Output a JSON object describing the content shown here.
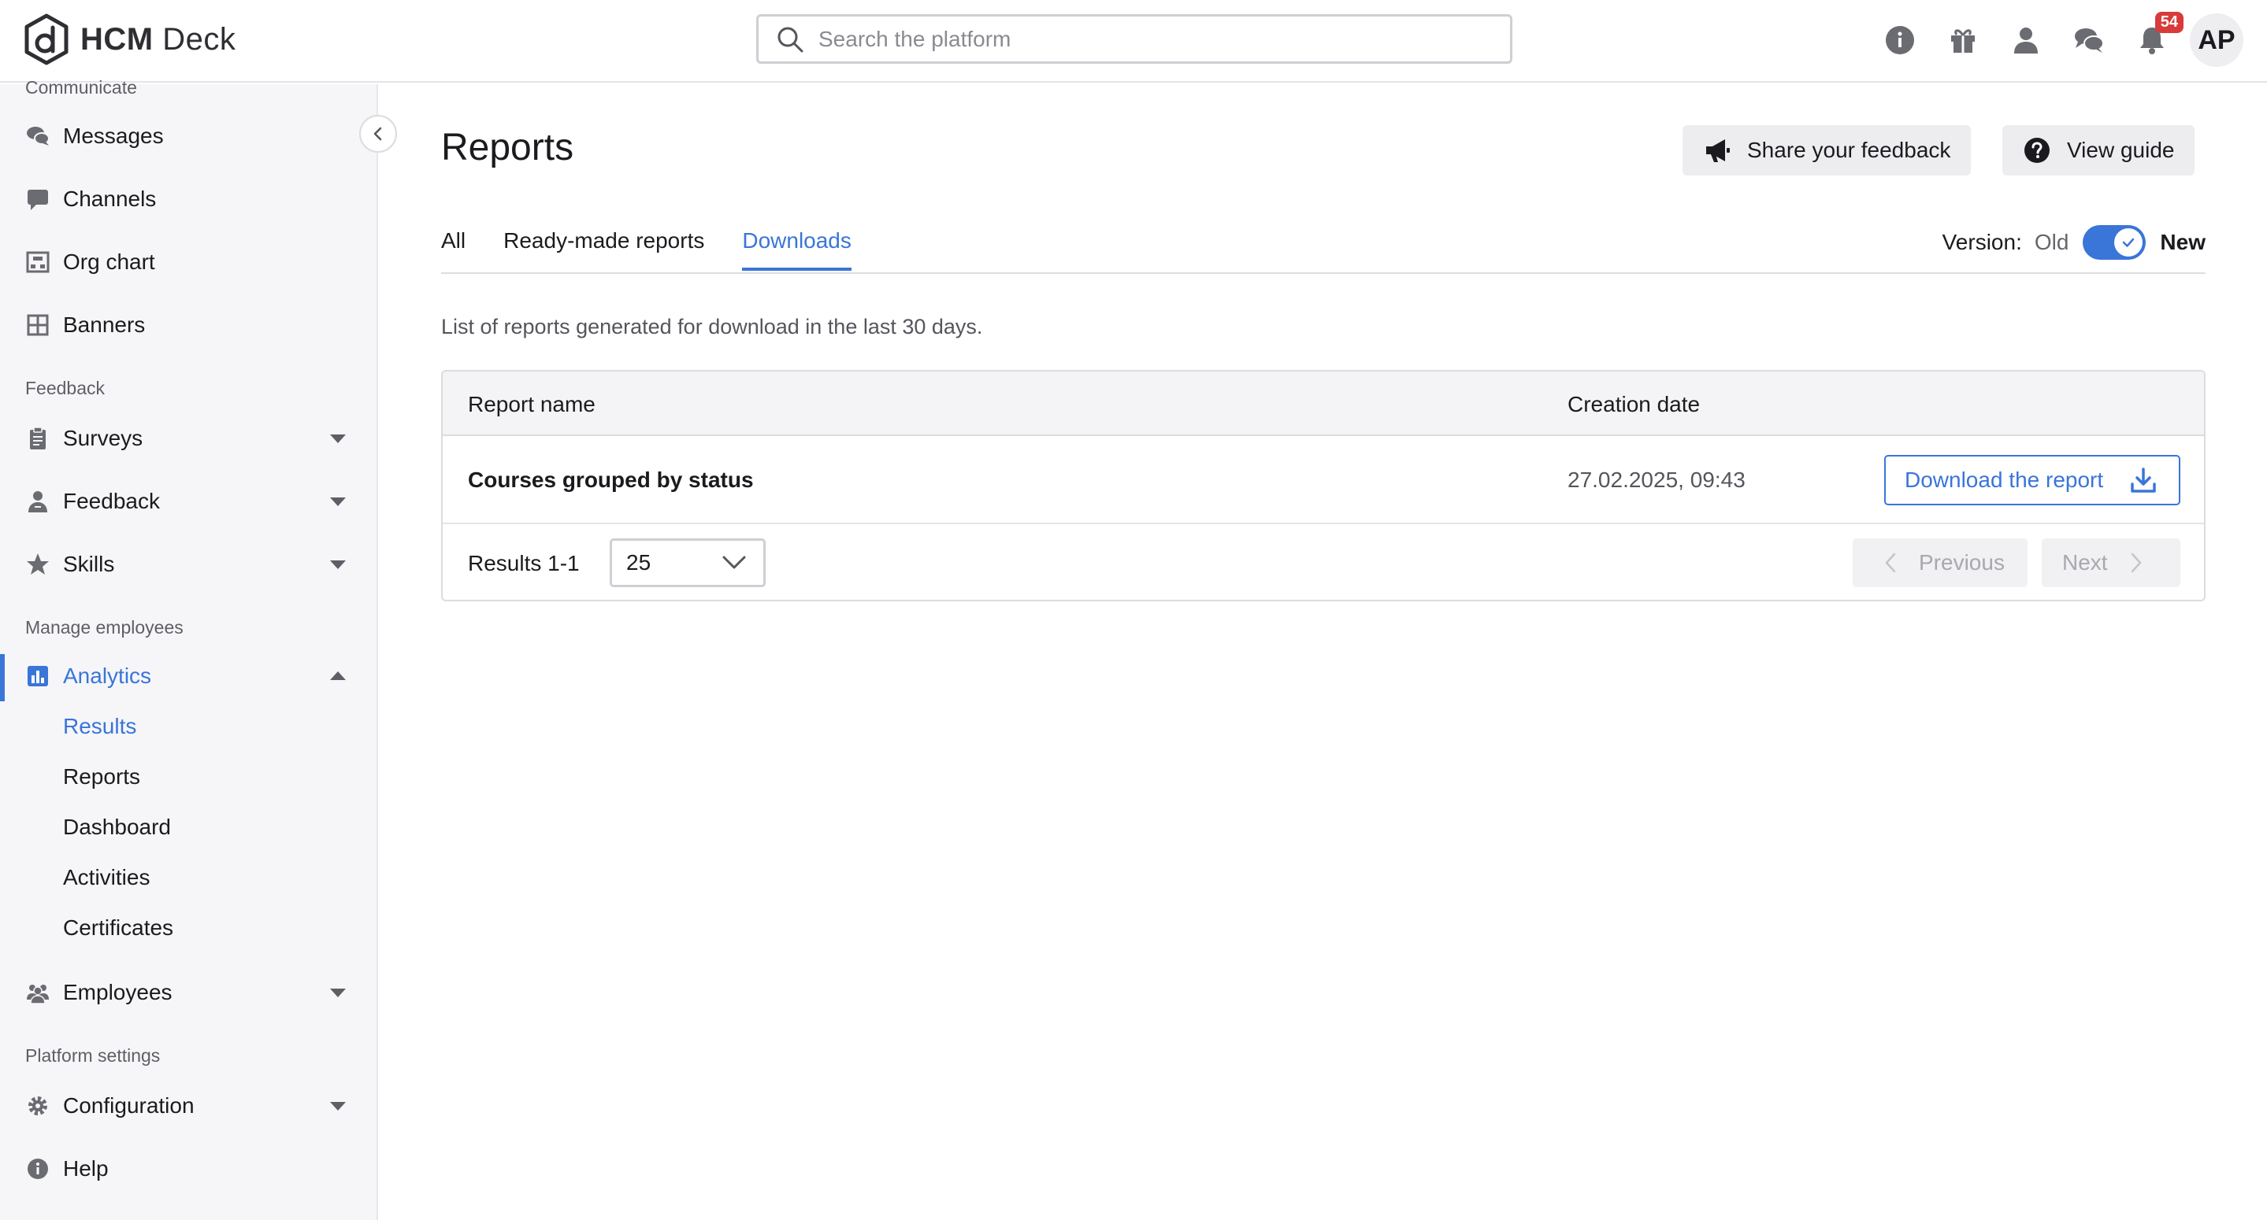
{
  "header": {
    "logo_bold": "HCM",
    "logo_light": "Deck",
    "search_placeholder": "Search the platform",
    "notifications_count": "54",
    "avatar_initials": "AP",
    "icons": [
      "info-icon",
      "gift-icon",
      "user-icon",
      "chat-icon",
      "bell-icon"
    ]
  },
  "sidebar": {
    "sections": {
      "communicate": "Communicate",
      "feedback": "Feedback",
      "manage_employees": "Manage employees",
      "platform_settings": "Platform settings"
    },
    "items": {
      "messages": "Messages",
      "channels": "Channels",
      "org_chart": "Org chart",
      "banners": "Banners",
      "surveys": "Surveys",
      "feedback": "Feedback",
      "skills": "Skills",
      "analytics": "Analytics",
      "employees": "Employees",
      "configuration": "Configuration",
      "help": "Help"
    },
    "analytics_sub": {
      "results": "Results",
      "reports": "Reports",
      "dashboard": "Dashboard",
      "activities": "Activities",
      "certificates": "Certificates"
    },
    "active_item": "Analytics",
    "active_sub": "Results"
  },
  "main": {
    "title": "Reports",
    "share_feedback": "Share your feedback",
    "view_guide": "View guide",
    "tabs": [
      "All",
      "Ready-made reports",
      "Downloads"
    ],
    "active_tab": "Downloads",
    "version_label": "Version:",
    "version_old": "Old",
    "version_new": "New",
    "description": "List of reports generated for download in the last 30 days.",
    "table": {
      "columns": [
        "Report name",
        "Creation date"
      ],
      "rows": [
        {
          "name": "Courses grouped by status",
          "date": "27.02.2025, 09:43",
          "action": "Download the report"
        }
      ]
    },
    "pagination": {
      "results": "Results 1-1",
      "page_size": "25",
      "previous": "Previous",
      "next": "Next"
    }
  },
  "colors": {
    "accent": "#3a75d8",
    "badge": "#d93a3a",
    "sidebar_bg": "#f6f6f8"
  }
}
